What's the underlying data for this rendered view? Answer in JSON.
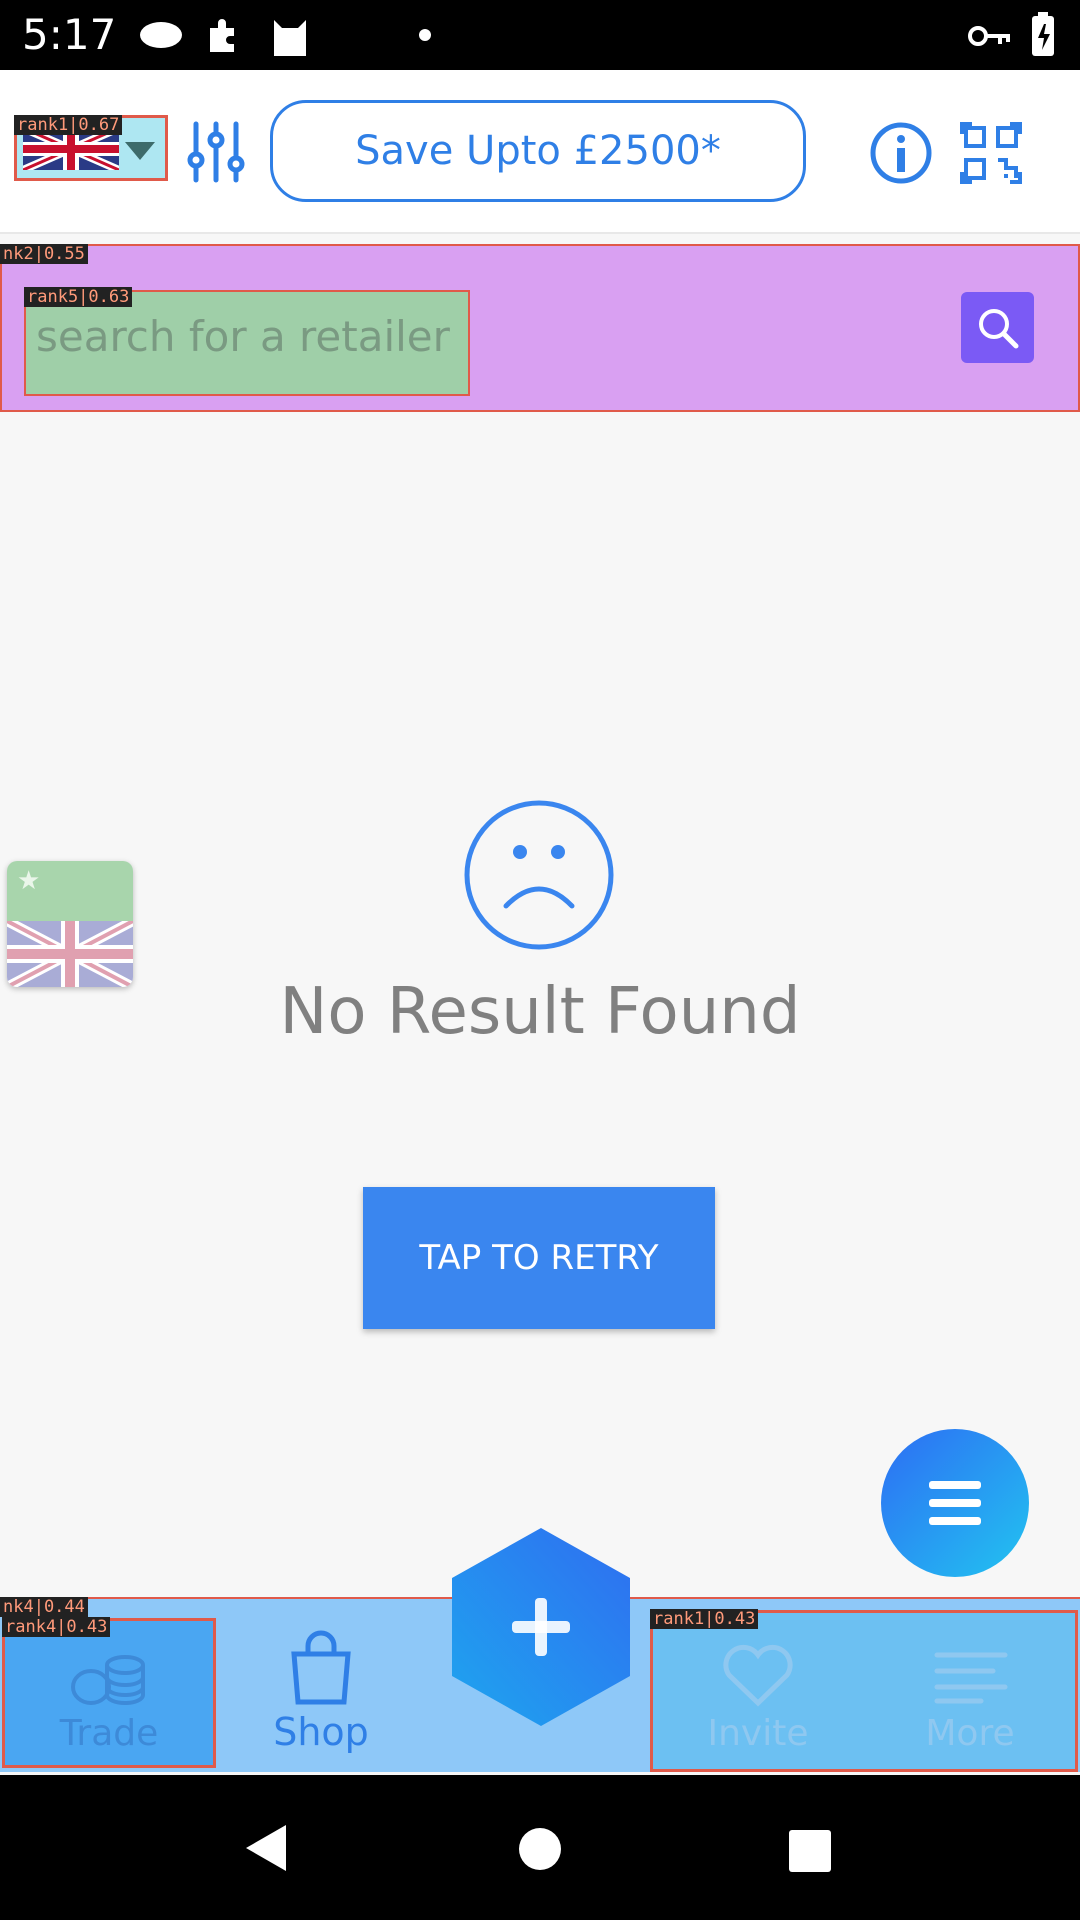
{
  "status_bar": {
    "time": "5:17"
  },
  "header": {
    "promo_label": "Save Upto £2500*"
  },
  "search": {
    "placeholder": "search for a retailer"
  },
  "empty_state": {
    "title": "No Result Found",
    "retry_label": "TAP TO RETRY"
  },
  "bottom_nav": {
    "items": [
      {
        "label": "Trade"
      },
      {
        "label": "Shop"
      },
      {
        "label": "Invite"
      },
      {
        "label": "More"
      }
    ]
  },
  "annotations": {
    "tags": [
      "rank1|0.67",
      "nk2|0.55",
      "rank5|0.63",
      "nk4|0.44",
      "rank4|0.43",
      "rank1|0.43"
    ]
  },
  "colors": {
    "accent": "#2f7fe6",
    "search_band": "#d9a0f2",
    "retry": "#3a86ef",
    "bottom_nav": "#8ec8f8"
  }
}
